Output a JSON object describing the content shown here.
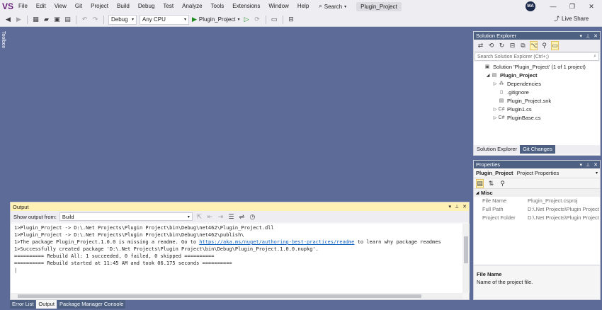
{
  "menu": {
    "logo": "VS",
    "items": [
      "File",
      "Edit",
      "View",
      "Git",
      "Project",
      "Build",
      "Debug",
      "Test",
      "Analyze",
      "Tools",
      "Extensions",
      "Window",
      "Help"
    ],
    "search_label": "Search",
    "window_title": "Plugin_Project",
    "avatar": "MA"
  },
  "toolbar": {
    "config": "Debug",
    "platform": "Any CPU",
    "run_target": "Plugin_Project",
    "live_share": "Live Share"
  },
  "toolbox": {
    "label": "Toolbox"
  },
  "solution_explorer": {
    "title": "Solution Explorer",
    "search_placeholder": "Search Solution Explorer (Ctrl+;)",
    "tree": [
      {
        "label": "Solution 'Plugin_Project' (1 of 1 project)",
        "icon": "solution-icon",
        "glyph": "▣",
        "expander": "",
        "indent": 0,
        "bold": false
      },
      {
        "label": "Plugin_Project",
        "icon": "project-icon",
        "glyph": "▤",
        "expander": "◢",
        "indent": 1,
        "bold": true
      },
      {
        "label": "Dependencies",
        "icon": "dependencies-icon",
        "glyph": "⁂",
        "expander": "▷",
        "indent": 2,
        "bold": false
      },
      {
        "label": ".gitignore",
        "icon": "file-icon",
        "glyph": "▯",
        "expander": "",
        "indent": 2,
        "bold": false
      },
      {
        "label": "Plugin_Project.snk",
        "icon": "key-file-icon",
        "glyph": "▤",
        "expander": "",
        "indent": 2,
        "bold": false
      },
      {
        "label": "Plugin1.cs",
        "icon": "csharp-file-icon",
        "glyph": "C#",
        "expander": "▷",
        "indent": 2,
        "bold": false
      },
      {
        "label": "PluginBase.cs",
        "icon": "csharp-file-icon",
        "glyph": "C#",
        "expander": "▷",
        "indent": 2,
        "bold": false
      }
    ],
    "tabs": [
      "Solution Explorer",
      "Git Changes"
    ]
  },
  "properties": {
    "title": "Properties",
    "object_name": "Plugin_Project",
    "object_type": "Project Properties",
    "category": "Misc",
    "rows": [
      {
        "key": "File Name",
        "value": "Plugin_Project.csproj"
      },
      {
        "key": "Full Path",
        "value": "D:\\.Net Projects\\Plugin Project"
      },
      {
        "key": "Project Folder",
        "value": "D:\\.Net Projects\\Plugin Project"
      }
    ],
    "desc_title": "File Name",
    "desc_text": "Name of the project file."
  },
  "output": {
    "title": "Output",
    "show_from_label": "Show output from:",
    "source": "Build",
    "lines": [
      {
        "pre": "1>Plugin_Project -> D:\\.Net Projects\\Plugin Project\\bin\\Debug\\net462\\Plugin_Project.dll",
        "link": "",
        "post": ""
      },
      {
        "pre": "1>Plugin_Project -> D:\\.Net Projects\\Plugin Project\\bin\\Debug\\net462\\publish\\",
        "link": "",
        "post": ""
      },
      {
        "pre": "1>The package Plugin_Project.1.0.0 is missing a readme. Go to ",
        "link": "https://aka.ms/nuget/authoring-best-practices/readme",
        "post": " to learn why package readmes"
      },
      {
        "pre": "1>Successfully created package 'D:\\.Net Projects\\Plugin Project\\bin\\Debug\\Plugin_Project.1.0.0.nupkg'.",
        "link": "",
        "post": ""
      },
      {
        "pre": "========== Rebuild All: 1 succeeded, 0 failed, 0 skipped ==========",
        "link": "",
        "post": ""
      },
      {
        "pre": "========== Rebuild started at 11:45 AM and took 06.175 seconds ==========",
        "link": "",
        "post": ""
      }
    ]
  },
  "bottom_tabs": [
    {
      "label": "Error List",
      "active": false
    },
    {
      "label": "Output",
      "active": true
    },
    {
      "label": "Package Manager Console",
      "active": false
    }
  ]
}
